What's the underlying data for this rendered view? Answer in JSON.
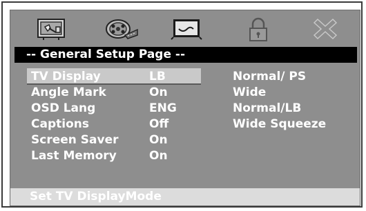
{
  "header": {
    "title": "-- General Setup Page --"
  },
  "tabs": [
    {
      "icon": "tv-settings-icon",
      "selected": false
    },
    {
      "icon": "audio-reel-icon",
      "selected": false
    },
    {
      "icon": "video-icon",
      "selected": false
    },
    {
      "icon": "lock-icon",
      "selected": false
    },
    {
      "icon": "exit-icon",
      "selected": false
    }
  ],
  "settings": [
    {
      "label": "TV Display",
      "value": "LB"
    },
    {
      "label": "Angle Mark",
      "value": "On"
    },
    {
      "label": "OSD Lang",
      "value": "ENG"
    },
    {
      "label": "Captions",
      "value": "Off"
    },
    {
      "label": "Screen Saver",
      "value": "On"
    },
    {
      "label": "Last Memory",
      "value": "On"
    }
  ],
  "options": [
    "Normal/ PS",
    "Wide",
    "Normal/LB",
    "Wide Squeeze"
  ],
  "status": {
    "text": "Set TV DisplayMode"
  },
  "colors": {
    "panel": "#8e8e8e",
    "title_bar": "#000000",
    "highlight": "#c9c9c9",
    "text": "#ffffff"
  }
}
